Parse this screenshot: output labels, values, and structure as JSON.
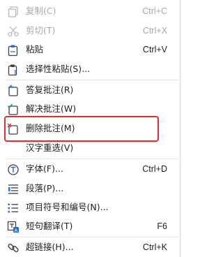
{
  "menu": {
    "items": [
      {
        "label": "复制(C)",
        "shortcut": "Ctrl+C",
        "icon": "copy-icon",
        "enabled": false
      },
      {
        "label": "剪切(T)",
        "shortcut": "Ctrl+X",
        "icon": "scissors-icon",
        "enabled": false
      },
      {
        "label": "粘贴",
        "shortcut": "Ctrl+V",
        "icon": "paste-icon",
        "enabled": true
      },
      {
        "label": "选择性粘贴(S)...",
        "shortcut": "",
        "icon": "paste-special-icon",
        "enabled": true
      },
      {
        "label": "答复批注(R)",
        "shortcut": "",
        "icon": "reply-comment-icon",
        "enabled": true
      },
      {
        "label": "解决批注(W)",
        "shortcut": "",
        "icon": "resolve-comment-icon",
        "enabled": true
      },
      {
        "label": "删除批注(M)",
        "shortcut": "",
        "icon": "delete-comment-icon",
        "enabled": true
      },
      {
        "label": "汉字重选(V)",
        "shortcut": "",
        "icon": "",
        "enabled": true
      },
      {
        "label": "字体(F)...",
        "shortcut": "Ctrl+D",
        "icon": "font-icon",
        "enabled": true
      },
      {
        "label": "段落(P)...",
        "shortcut": "",
        "icon": "paragraph-icon",
        "enabled": true
      },
      {
        "label": "项目符号和编号(N)...",
        "shortcut": "",
        "icon": "bullet-list-icon",
        "enabled": true
      },
      {
        "label": "短句翻译(T)",
        "shortcut": "F6",
        "icon": "translate-icon",
        "enabled": true
      },
      {
        "label": "超链接(H)...",
        "shortcut": "Ctrl+K",
        "icon": "hyperlink-icon",
        "enabled": true
      }
    ]
  },
  "colors": {
    "highlight_border": "#e8292e",
    "icon_blue": "#2b6fd6",
    "icon_red": "#e03b3b",
    "icon_dark": "#3a3f4a",
    "disabled_text": "#a8a8a8"
  }
}
